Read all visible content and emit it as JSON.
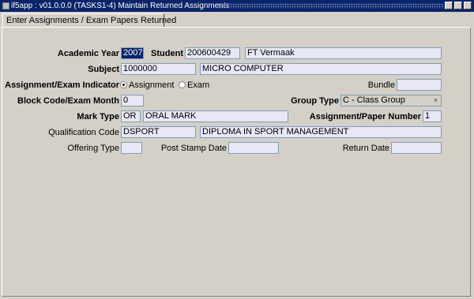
{
  "window": {
    "title": "if5app : v01.0.0.0 (TASKS1-4) Maintain Returned Assignments"
  },
  "tab": {
    "label": "Enter Assignments / Exam Papers Returned"
  },
  "form": {
    "academic_year": {
      "label": "Academic Year",
      "value": "2007"
    },
    "student": {
      "label": "Student",
      "number": "200600429",
      "name": "FT Vermaak"
    },
    "subject": {
      "label": "Subject",
      "code": "1000000",
      "name": "MICRO COMPUTER"
    },
    "indicator": {
      "label": "Assignment/Exam Indicator",
      "option_assignment": "Assignment",
      "option_exam": "Exam",
      "selected": "Assignment"
    },
    "bundle": {
      "label": "Bundle",
      "value": ""
    },
    "block_code": {
      "label": "Block Code/Exam Month",
      "value": "0"
    },
    "group_type": {
      "label": "Group Type",
      "value": "C - Class Group"
    },
    "mark_type": {
      "label": "Mark Type",
      "code": "OR",
      "name": "ORAL MARK"
    },
    "paper_number": {
      "label": "Assignment/Paper Number",
      "value": "1"
    },
    "qualification": {
      "label": "Qualification Code",
      "code": "DSPORT",
      "name": "DIPLOMA IN SPORT MANAGEMENT"
    },
    "offering_type": {
      "label": "Offering Type",
      "value": ""
    },
    "post_stamp_date": {
      "label": "Post Stamp Date",
      "value": ""
    },
    "return_date": {
      "label": "Return Date",
      "value": ""
    }
  },
  "colors": {
    "titlebar": "#0a246a",
    "field_bg": "#e7e7f5",
    "window_bg": "#d4d0c8"
  }
}
